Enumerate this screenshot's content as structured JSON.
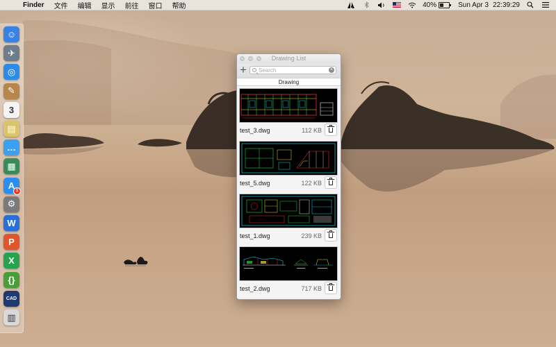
{
  "menubar": {
    "apple_glyph": "",
    "app_name": "Finder",
    "menus": [
      "文件",
      "编辑",
      "显示",
      "前往",
      "窗口",
      "帮助"
    ],
    "battery_percent": "40%",
    "battery_level": 0.4,
    "date": "Sun Apr 3",
    "time": "22:39:29",
    "status_icons": [
      "adobe-icon",
      "bluetooth-icon",
      "volume-icon",
      "flag-icon",
      "wifi-icon",
      "battery-icon",
      "search-icon",
      "list-icon"
    ]
  },
  "dock": {
    "apps": [
      {
        "name": "finder",
        "glyph": "☺",
        "color": "#3b82e0"
      },
      {
        "name": "launchpad",
        "glyph": "✈",
        "color": "#6e7d8c"
      },
      {
        "name": "safari",
        "glyph": "◎",
        "color": "#2b8be6"
      },
      {
        "name": "notes",
        "glyph": "✎",
        "color": "#b8864a"
      },
      {
        "name": "calendar",
        "glyph": "3",
        "color": "#f4f4f4"
      },
      {
        "name": "preview",
        "glyph": "▤",
        "color": "#d9c56b"
      },
      {
        "name": "messages",
        "glyph": "…",
        "color": "#3aa0f2"
      },
      {
        "name": "photo",
        "glyph": "▦",
        "color": "#3c8a5c"
      },
      {
        "name": "app-store",
        "glyph": "A",
        "color": "#2a8ef0",
        "badge": "1"
      },
      {
        "name": "system-preferences",
        "glyph": "⚙",
        "color": "#7a7a7a"
      },
      {
        "name": "word",
        "glyph": "W",
        "color": "#2a6fd6"
      },
      {
        "name": "powerpoint",
        "glyph": "P",
        "color": "#e0552b"
      },
      {
        "name": "excel",
        "glyph": "X",
        "color": "#27a24e"
      },
      {
        "name": "script-editor",
        "glyph": "{}",
        "color": "#4a9e3a"
      },
      {
        "name": "cad-viewer",
        "glyph": "CAD",
        "color": "#1f3a70"
      },
      {
        "name": "trash",
        "glyph": "▥",
        "color": "#d9d9d9"
      }
    ]
  },
  "window": {
    "title": "Drawing List",
    "add_label": "+",
    "search_placeholder": "Search",
    "search_value": "",
    "list_header": "Drawing",
    "items": [
      {
        "name": "test_3.dwg",
        "size": "112 KB"
      },
      {
        "name": "test_5.dwg",
        "size": "122 KB"
      },
      {
        "name": "test_1.dwg",
        "size": "239 KB"
      },
      {
        "name": "test_2.dwg",
        "size": "717 KB"
      }
    ]
  },
  "colors": {
    "cad_red": "#e0302a",
    "cad_green": "#22d03a",
    "cad_cyan": "#1fd4e0",
    "cad_yellow": "#e8e03a",
    "cad_white": "#e8e8e8"
  }
}
